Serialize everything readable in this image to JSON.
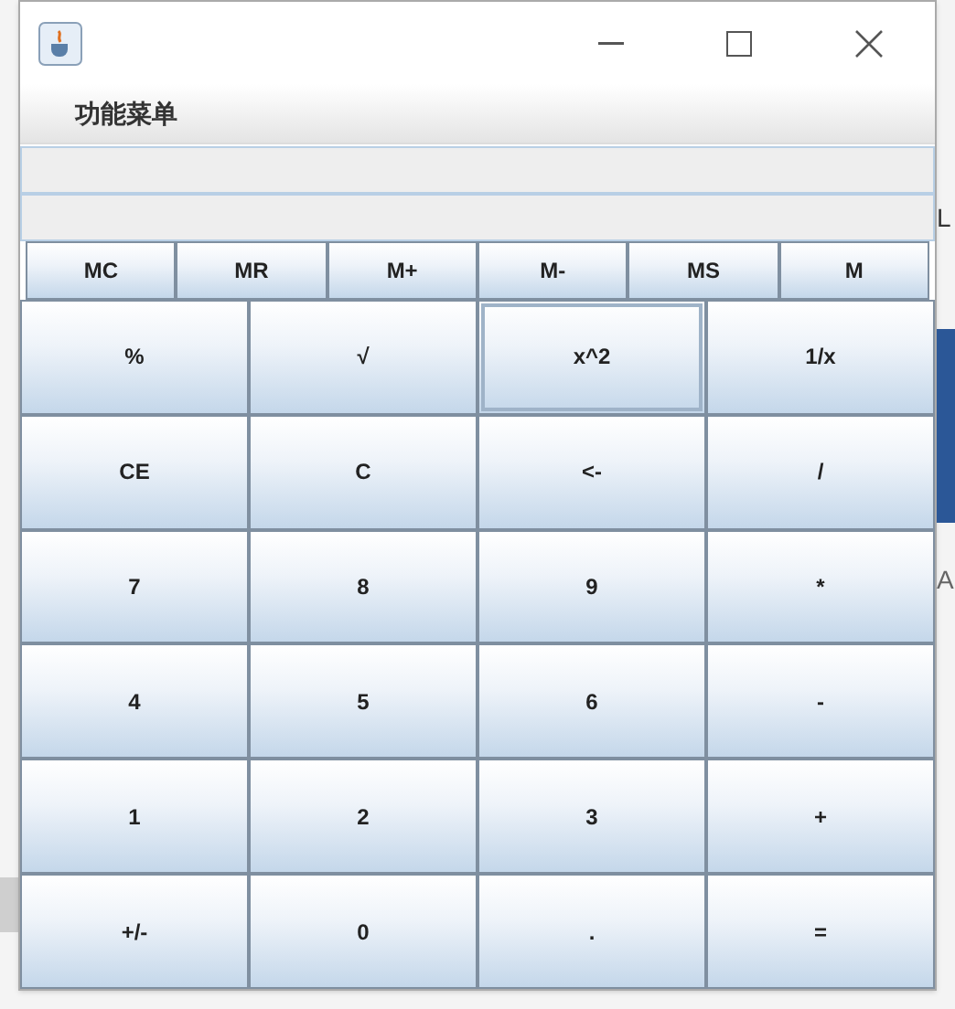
{
  "menu": [
    "功能菜单"
  ],
  "memory_buttons": [
    "MC",
    "MR",
    "M+",
    "M-",
    "MS",
    "M"
  ],
  "keys": [
    {
      "label": "%",
      "selected": false
    },
    {
      "label": "√",
      "selected": false
    },
    {
      "label": "x^2",
      "selected": true
    },
    {
      "label": "1/x",
      "selected": false
    },
    {
      "label": "CE",
      "selected": false
    },
    {
      "label": "C",
      "selected": false
    },
    {
      "label": "<-",
      "selected": false
    },
    {
      "label": "/",
      "selected": false
    },
    {
      "label": "7",
      "selected": false
    },
    {
      "label": "8",
      "selected": false
    },
    {
      "label": "9",
      "selected": false
    },
    {
      "label": "*",
      "selected": false
    },
    {
      "label": "4",
      "selected": false
    },
    {
      "label": "5",
      "selected": false
    },
    {
      "label": "6",
      "selected": false
    },
    {
      "label": "-",
      "selected": false
    },
    {
      "label": "1",
      "selected": false
    },
    {
      "label": "2",
      "selected": false
    },
    {
      "label": "3",
      "selected": false
    },
    {
      "label": "+",
      "selected": false
    },
    {
      "label": "+/-",
      "selected": false
    },
    {
      "label": "0",
      "selected": false
    },
    {
      "label": ".",
      "selected": false
    },
    {
      "label": "=",
      "selected": false
    }
  ],
  "background_text": [
    "L",
    "A"
  ]
}
